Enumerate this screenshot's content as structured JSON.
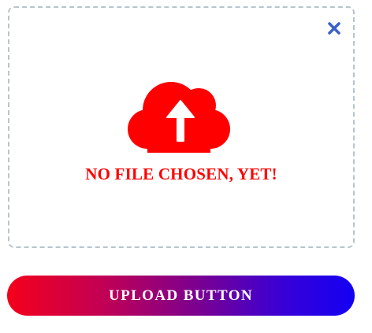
{
  "dropzone": {
    "status_text": "NO FILE CHOSEN, YET!",
    "cloud_icon": "cloud-upload-icon",
    "close_icon": "close-icon"
  },
  "upload_button": {
    "label": "UPLOAD BUTTON"
  },
  "colors": {
    "accent_red": "#ff0000",
    "close_blue": "#3a62c9",
    "dropzone_border": "#b9c3cf",
    "button_gradient_start": "#f5001a",
    "button_gradient_end": "#1400f3",
    "button_text": "#ffffff"
  }
}
